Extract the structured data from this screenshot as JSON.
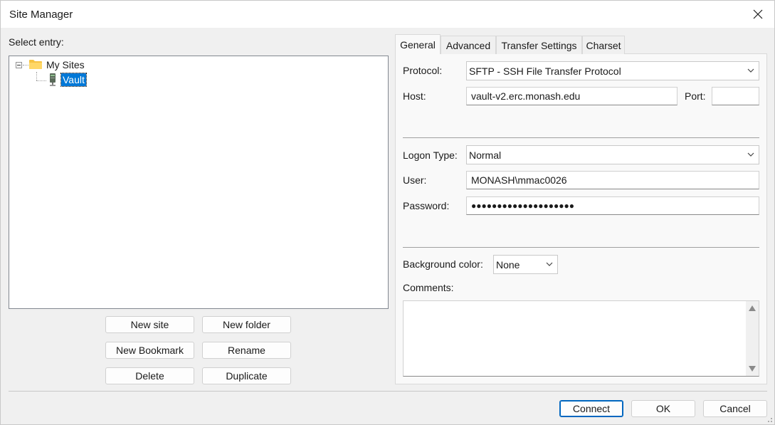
{
  "window": {
    "title": "Site Manager"
  },
  "left": {
    "select_entry_label": "Select entry:",
    "tree": {
      "root": {
        "label": "My Sites",
        "icon": "folder-icon"
      },
      "children": [
        {
          "label": "Vault",
          "icon": "server-icon",
          "selected": true
        }
      ]
    },
    "buttons": {
      "new_site": "New site",
      "new_folder": "New folder",
      "new_bookmark": "New Bookmark",
      "rename": "Rename",
      "delete": "Delete",
      "duplicate": "Duplicate"
    }
  },
  "tabs": [
    {
      "label": "General",
      "active": true
    },
    {
      "label": "Advanced"
    },
    {
      "label": "Transfer Settings"
    },
    {
      "label": "Charset"
    }
  ],
  "general": {
    "protocol_label": "Protocol:",
    "protocol_value": "SFTP - SSH File Transfer Protocol",
    "host_label": "Host:",
    "host_value": "vault-v2.erc.monash.edu",
    "port_label": "Port:",
    "port_value": "",
    "logon_type_label": "Logon Type:",
    "logon_type_value": "Normal",
    "user_label": "User:",
    "user_value": "MONASH\\mmac0026",
    "password_label": "Password:",
    "password_value": "●●●●●●●●●●●●●●●●●●●●",
    "background_color_label": "Background color:",
    "background_color_value": "None",
    "comments_label": "Comments:",
    "comments_value": ""
  },
  "footer": {
    "connect": "Connect",
    "ok": "OK",
    "cancel": "Cancel"
  },
  "colors": {
    "selection": "#0078d7",
    "accent": "#0067c0",
    "folder": "#f6c343"
  }
}
